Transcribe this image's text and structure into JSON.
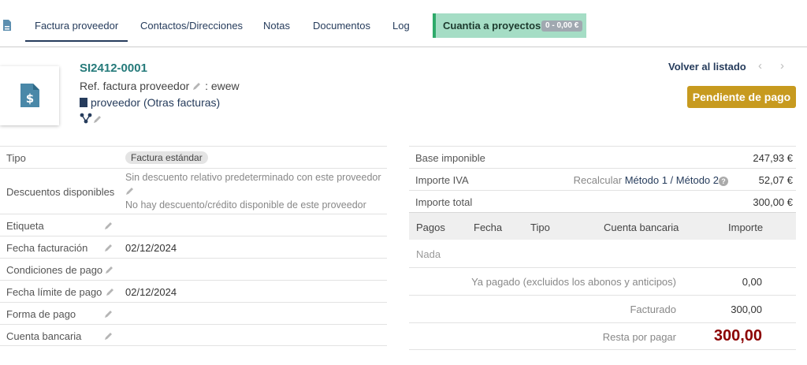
{
  "tabs": [
    {
      "label": "Factura proveedor",
      "active": true
    },
    {
      "label": "Contactos/Direcciones"
    },
    {
      "label": "Notas"
    },
    {
      "label": "Documentos"
    },
    {
      "label": "Log"
    }
  ],
  "project_tab": {
    "label": "Cuantia a proyectos",
    "badge": "0 - 0,00 €"
  },
  "header": {
    "ref": "SI2412-0001",
    "ref_supplier_label": "Ref. factura proveedor",
    "ref_supplier_value": ": ewew",
    "supplier_name": "proveedor",
    "supplier_link": "(Otras facturas)",
    "back_label": "Volver al listado",
    "status": "Pendiente de pago",
    "prev_arrow": "‹",
    "next_arrow": "›"
  },
  "left_fields": {
    "tipo_label": "Tipo",
    "tipo_value": "Factura estándar",
    "descuentos_label": "Descuentos disponibles",
    "descuentos_line1": "Sin descuento relativo predeterminado con este proveedor",
    "descuentos_line2": "No hay descuento/crédito disponible de este proveedor",
    "etiqueta_label": "Etiqueta",
    "fecha_label": "Fecha facturación",
    "fecha_value": "02/12/2024",
    "condiciones_label": "Condiciones de pago",
    "limite_label": "Fecha límite de pago",
    "limite_value": "02/12/2024",
    "forma_label": "Forma de pago",
    "cuenta_label": "Cuenta bancaria"
  },
  "amounts": {
    "base_label": "Base imponible",
    "base_value": "247,93 €",
    "iva_label": "Importe IVA",
    "recalc_label": "Recalcular",
    "metodo1": "Método 1",
    "sep": "/",
    "metodo2": "Método 2",
    "iva_value": "52,07 €",
    "total_label": "Importe total",
    "total_value": "300,00 €"
  },
  "payments": {
    "headers": [
      "Pagos",
      "Fecha",
      "Tipo",
      "Cuenta bancaria",
      "Importe"
    ],
    "empty": "Nada",
    "paid_label": "Ya pagado (excluidos los abonos y anticipos)",
    "paid_value": "0,00",
    "billed_label": "Facturado",
    "billed_value": "300,00",
    "remaining_label": "Resta por pagar",
    "remaining_value": "300,00"
  },
  "colors": {
    "accent": "#263c5c",
    "status": "#c79a1f",
    "remaining": "#8b0000",
    "project_tab": "#a5ddc5"
  }
}
